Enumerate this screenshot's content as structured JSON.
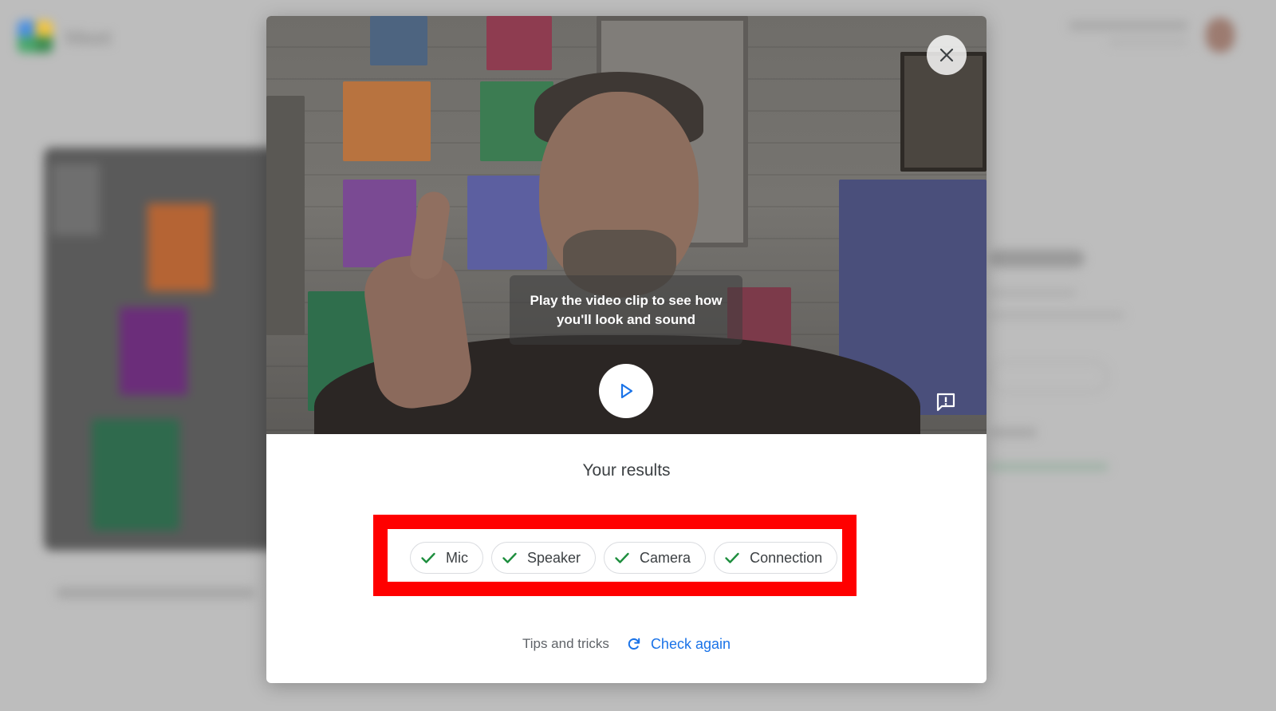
{
  "background": {
    "brand": "Meet",
    "brand_colors": [
      "#4285f4",
      "#fbbc04",
      "#34a853",
      "#1e8e3e"
    ]
  },
  "modal": {
    "video": {
      "tooltip": "Play the video clip to see how you'll look and sound",
      "close_icon": "close-icon",
      "play_icon": "play-icon",
      "feedback_icon": "feedback-icon"
    },
    "results_title": "Your results",
    "checks": [
      {
        "label": "Mic",
        "status": "passed",
        "icon": "check-icon"
      },
      {
        "label": "Speaker",
        "status": "passed",
        "icon": "check-icon"
      },
      {
        "label": "Camera",
        "status": "passed",
        "icon": "check-icon"
      },
      {
        "label": "Connection",
        "status": "passed",
        "icon": "check-icon"
      }
    ],
    "footer": {
      "tips_label": "Tips and tricks",
      "check_again_label": "Check again",
      "check_again_icon": "refresh-icon"
    }
  },
  "colors": {
    "accent": "#1a73e8",
    "check_green": "#1e8e3e",
    "highlight": "#ff0000",
    "text": "#3c4043"
  }
}
